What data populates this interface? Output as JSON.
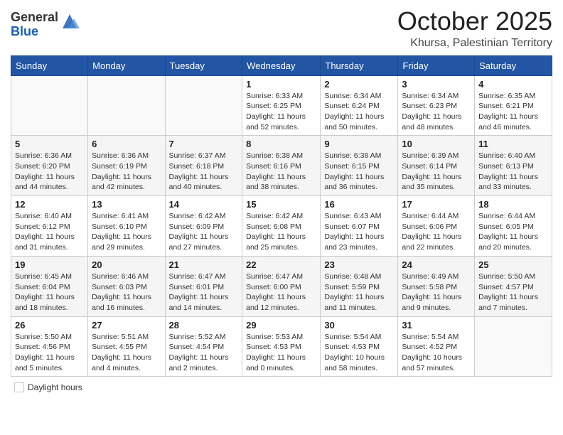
{
  "header": {
    "logo_general": "General",
    "logo_blue": "Blue",
    "month_title": "October 2025",
    "location": "Khursa, Palestinian Territory"
  },
  "weekdays": [
    "Sunday",
    "Monday",
    "Tuesday",
    "Wednesday",
    "Thursday",
    "Friday",
    "Saturday"
  ],
  "weeks": [
    [
      {
        "day": "",
        "info": ""
      },
      {
        "day": "",
        "info": ""
      },
      {
        "day": "",
        "info": ""
      },
      {
        "day": "1",
        "info": "Sunrise: 6:33 AM\nSunset: 6:25 PM\nDaylight: 11 hours\nand 52 minutes."
      },
      {
        "day": "2",
        "info": "Sunrise: 6:34 AM\nSunset: 6:24 PM\nDaylight: 11 hours\nand 50 minutes."
      },
      {
        "day": "3",
        "info": "Sunrise: 6:34 AM\nSunset: 6:23 PM\nDaylight: 11 hours\nand 48 minutes."
      },
      {
        "day": "4",
        "info": "Sunrise: 6:35 AM\nSunset: 6:21 PM\nDaylight: 11 hours\nand 46 minutes."
      }
    ],
    [
      {
        "day": "5",
        "info": "Sunrise: 6:36 AM\nSunset: 6:20 PM\nDaylight: 11 hours\nand 44 minutes."
      },
      {
        "day": "6",
        "info": "Sunrise: 6:36 AM\nSunset: 6:19 PM\nDaylight: 11 hours\nand 42 minutes."
      },
      {
        "day": "7",
        "info": "Sunrise: 6:37 AM\nSunset: 6:18 PM\nDaylight: 11 hours\nand 40 minutes."
      },
      {
        "day": "8",
        "info": "Sunrise: 6:38 AM\nSunset: 6:16 PM\nDaylight: 11 hours\nand 38 minutes."
      },
      {
        "day": "9",
        "info": "Sunrise: 6:38 AM\nSunset: 6:15 PM\nDaylight: 11 hours\nand 36 minutes."
      },
      {
        "day": "10",
        "info": "Sunrise: 6:39 AM\nSunset: 6:14 PM\nDaylight: 11 hours\nand 35 minutes."
      },
      {
        "day": "11",
        "info": "Sunrise: 6:40 AM\nSunset: 6:13 PM\nDaylight: 11 hours\nand 33 minutes."
      }
    ],
    [
      {
        "day": "12",
        "info": "Sunrise: 6:40 AM\nSunset: 6:12 PM\nDaylight: 11 hours\nand 31 minutes."
      },
      {
        "day": "13",
        "info": "Sunrise: 6:41 AM\nSunset: 6:10 PM\nDaylight: 11 hours\nand 29 minutes."
      },
      {
        "day": "14",
        "info": "Sunrise: 6:42 AM\nSunset: 6:09 PM\nDaylight: 11 hours\nand 27 minutes."
      },
      {
        "day": "15",
        "info": "Sunrise: 6:42 AM\nSunset: 6:08 PM\nDaylight: 11 hours\nand 25 minutes."
      },
      {
        "day": "16",
        "info": "Sunrise: 6:43 AM\nSunset: 6:07 PM\nDaylight: 11 hours\nand 23 minutes."
      },
      {
        "day": "17",
        "info": "Sunrise: 6:44 AM\nSunset: 6:06 PM\nDaylight: 11 hours\nand 22 minutes."
      },
      {
        "day": "18",
        "info": "Sunrise: 6:44 AM\nSunset: 6:05 PM\nDaylight: 11 hours\nand 20 minutes."
      }
    ],
    [
      {
        "day": "19",
        "info": "Sunrise: 6:45 AM\nSunset: 6:04 PM\nDaylight: 11 hours\nand 18 minutes."
      },
      {
        "day": "20",
        "info": "Sunrise: 6:46 AM\nSunset: 6:03 PM\nDaylight: 11 hours\nand 16 minutes."
      },
      {
        "day": "21",
        "info": "Sunrise: 6:47 AM\nSunset: 6:01 PM\nDaylight: 11 hours\nand 14 minutes."
      },
      {
        "day": "22",
        "info": "Sunrise: 6:47 AM\nSunset: 6:00 PM\nDaylight: 11 hours\nand 12 minutes."
      },
      {
        "day": "23",
        "info": "Sunrise: 6:48 AM\nSunset: 5:59 PM\nDaylight: 11 hours\nand 11 minutes."
      },
      {
        "day": "24",
        "info": "Sunrise: 6:49 AM\nSunset: 5:58 PM\nDaylight: 11 hours\nand 9 minutes."
      },
      {
        "day": "25",
        "info": "Sunrise: 5:50 AM\nSunset: 4:57 PM\nDaylight: 11 hours\nand 7 minutes."
      }
    ],
    [
      {
        "day": "26",
        "info": "Sunrise: 5:50 AM\nSunset: 4:56 PM\nDaylight: 11 hours\nand 5 minutes."
      },
      {
        "day": "27",
        "info": "Sunrise: 5:51 AM\nSunset: 4:55 PM\nDaylight: 11 hours\nand 4 minutes."
      },
      {
        "day": "28",
        "info": "Sunrise: 5:52 AM\nSunset: 4:54 PM\nDaylight: 11 hours\nand 2 minutes."
      },
      {
        "day": "29",
        "info": "Sunrise: 5:53 AM\nSunset: 4:53 PM\nDaylight: 11 hours\nand 0 minutes."
      },
      {
        "day": "30",
        "info": "Sunrise: 5:54 AM\nSunset: 4:53 PM\nDaylight: 10 hours\nand 58 minutes."
      },
      {
        "day": "31",
        "info": "Sunrise: 5:54 AM\nSunset: 4:52 PM\nDaylight: 10 hours\nand 57 minutes."
      },
      {
        "day": "",
        "info": ""
      }
    ]
  ],
  "legend": {
    "label": "Daylight hours"
  }
}
